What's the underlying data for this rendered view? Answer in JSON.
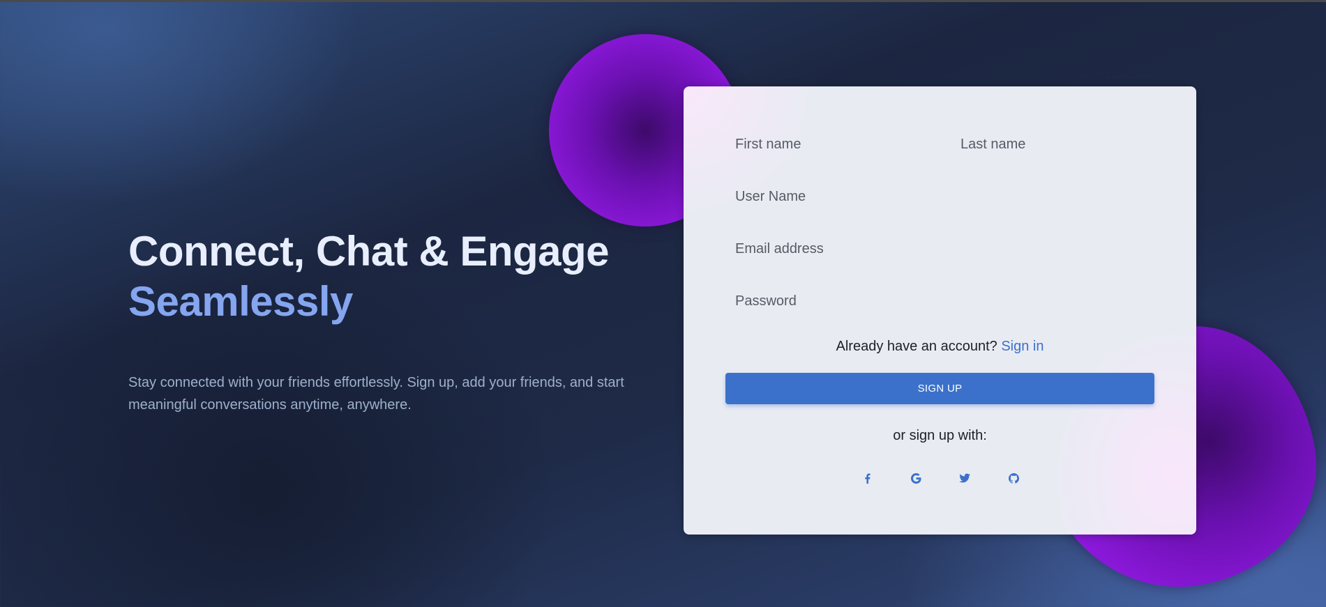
{
  "hero": {
    "title_line1": "Connect, Chat & Engage",
    "title_line2": "Seamlessly",
    "description": "Stay connected with your friends effortlessly. Sign up, add your friends, and start meaningful conversations anytime, anywhere."
  },
  "form": {
    "first_name_placeholder": "First name",
    "last_name_placeholder": "Last name",
    "username_placeholder": "User Name",
    "email_placeholder": "Email address",
    "password_placeholder": "Password",
    "already_account_text": "Already have an account?",
    "sign_in_link": "Sign in",
    "sign_up_button": "SIGN UP",
    "or_sign_up_with": "or sign up with:",
    "social_icons": [
      "facebook-icon",
      "google-icon",
      "twitter-icon",
      "github-icon"
    ]
  },
  "colors": {
    "accent_blue": "#3b71ca",
    "title_accent": "#85a5ef",
    "blob_purple": "#8a18d8"
  }
}
